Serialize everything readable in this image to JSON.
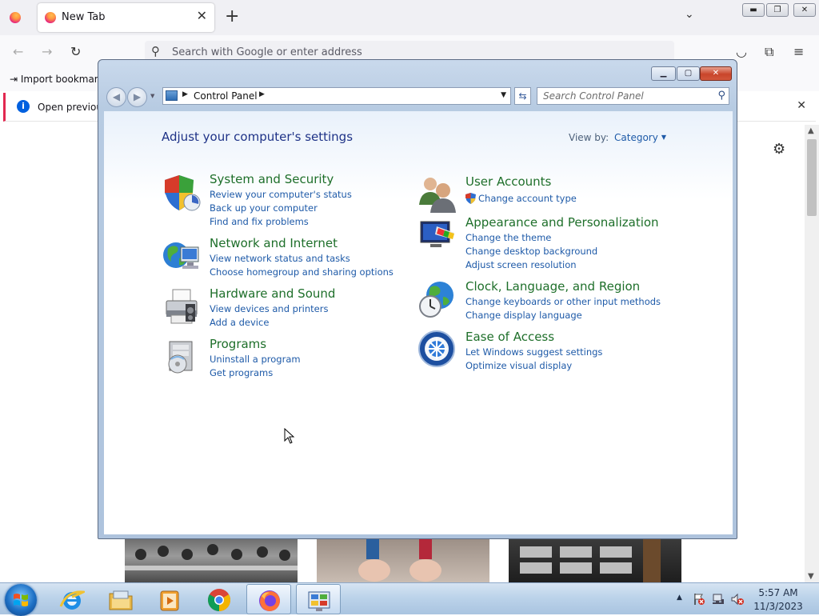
{
  "firefox": {
    "tab_title": "New Tab",
    "tab_close": "✕",
    "new_tab": "+",
    "list_all_tabs": "⌄",
    "search_placeholder": "Search with Google or enter address",
    "bookmark_import": "Import bookmark",
    "notice_text": "Open previous",
    "notice_close": "✕",
    "gear": "⚙"
  },
  "control_panel": {
    "breadcrumb": "Control Panel",
    "search_placeholder": "Search Control Panel",
    "heading": "Adjust your computer's settings",
    "view_by_label": "View by:",
    "view_by_value": "Category",
    "categories": [
      {
        "icon": "shield-icon",
        "title": "System and Security",
        "links": [
          "Review your computer's status",
          "Back up your computer",
          "Find and fix problems"
        ]
      },
      {
        "icon": "network-icon",
        "title": "Network and Internet",
        "links": [
          "View network status and tasks",
          "Choose homegroup and sharing options"
        ]
      },
      {
        "icon": "printer-icon",
        "title": "Hardware and Sound",
        "links": [
          "View devices and printers",
          "Add a device"
        ]
      },
      {
        "icon": "programs-icon",
        "title": "Programs",
        "links": [
          "Uninstall a program",
          "Get programs"
        ]
      },
      {
        "icon": "users-icon",
        "title": "User Accounts",
        "links": [
          "Change account type"
        ]
      },
      {
        "icon": "appearance-icon",
        "title": "Appearance and Personalization",
        "links": [
          "Change the theme",
          "Change desktop background",
          "Adjust screen resolution"
        ]
      },
      {
        "icon": "clock-globe-icon",
        "title": "Clock, Language, and Region",
        "links": [
          "Change keyboards or other input methods",
          "Change display language"
        ]
      },
      {
        "icon": "ease-of-access-icon",
        "title": "Ease of Access",
        "links": [
          "Let Windows suggest settings",
          "Optimize visual display"
        ]
      }
    ]
  },
  "taskbar": {
    "time": "5:57 AM",
    "date": "11/3/2023"
  },
  "colors": {
    "cp_title_green": "#1e6f2a",
    "cp_link_blue": "#1e5aa8",
    "cp_heading": "#1e3287"
  }
}
